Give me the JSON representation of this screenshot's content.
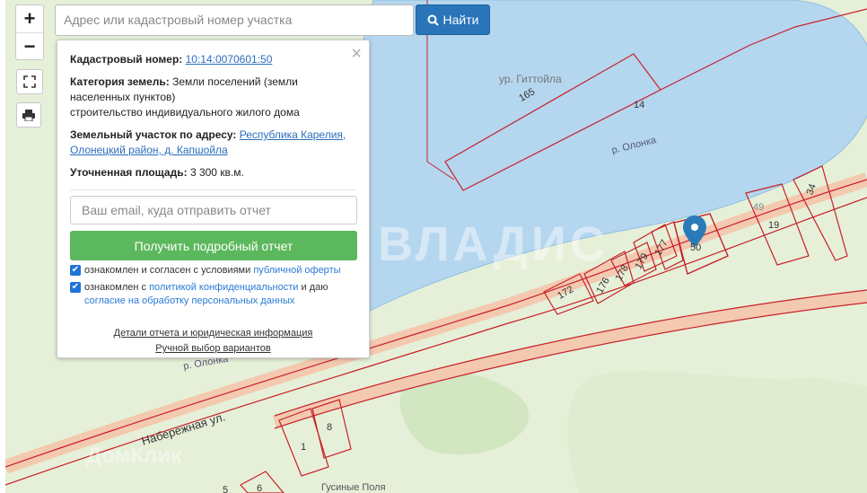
{
  "search": {
    "placeholder": "Адрес или кадастровый номер участка",
    "button_label": "Найти"
  },
  "zoom": {
    "plus": "+",
    "minus": "−"
  },
  "icons": {
    "search": "search-icon",
    "fullscreen": "fullscreen-icon",
    "print": "print-icon",
    "close": "close-icon",
    "marker": "map-marker-icon",
    "checkbox": "checkmark-icon"
  },
  "colors": {
    "water": "#b5d6ef",
    "land": "#e6f0d8",
    "parcel_border": "#c8202a",
    "button_blue": "#2a74b9",
    "button_green": "#5cb85c"
  },
  "popup": {
    "close": "×",
    "cadastral_label": "Кадастровый номер:",
    "cadastral_value": "10:14:0070601:50",
    "category_label": "Категория земель:",
    "category_value": "Земли поселений (земли населенных пунктов)",
    "usage": "строительство индивидуального жилого дома",
    "address_label": "Земельный участок по адресу:",
    "address_value": "Республика Карелия, Олонецкий район, д. Капшойла",
    "area_label": "Уточненная площадь:",
    "area_value": "3 300 кв.м.",
    "email_placeholder": "Ваш email, куда отправить отчет",
    "report_button": "Получить подробный отчет",
    "consent1_text": "ознакомлен и согласен с условиями",
    "consent1_link": "публичной оферты",
    "consent2_text": "ознакомлен с",
    "consent2_link": "политикой конфиденциальности",
    "consent2_mid": "и даю",
    "consent2_link2": "согласие на обработку персональных данных",
    "details_link": "Детали отчета и юридическая информация",
    "manual_link": "Ручной выбор вариантов"
  },
  "map": {
    "place_name": "ур. Гиттойла",
    "river1": "р. Олонка",
    "river2": "р. Олонка",
    "street": "Набережная ул.",
    "village": "Гусиные Поля",
    "road_number": "14",
    "watermark": "ВЛАДИС",
    "watermark2": "ДомКлик",
    "parcels": [
      "165",
      "172",
      "176",
      "178",
      "179",
      "177",
      "50",
      "49",
      "19",
      "34",
      "8",
      "1",
      "6",
      "5"
    ]
  }
}
